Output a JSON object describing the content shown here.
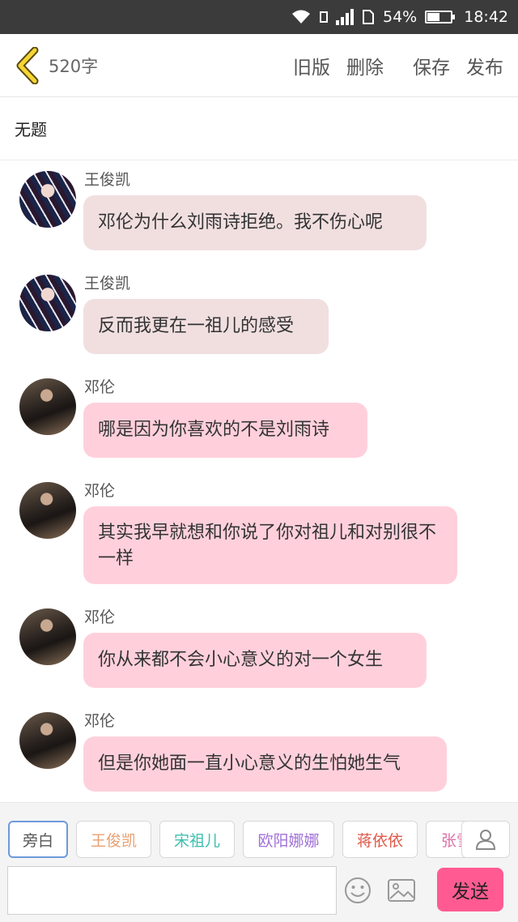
{
  "status": {
    "battery_text": "54%",
    "battery_level": 0.54,
    "time": "18:42"
  },
  "toolbar": {
    "word_count": "520字",
    "old_version": "旧版",
    "delete": "删除",
    "save": "保存",
    "publish": "发布"
  },
  "title": "无题",
  "messages": [
    {
      "sender": "王俊凯",
      "text": "邓伦为什么刘雨诗拒绝。我不伤心呢",
      "avatar": "avatar-wang-junkai"
    },
    {
      "sender": "王俊凯",
      "text": "反而我更在一祖儿的感受",
      "avatar": "avatar-wang-junkai"
    },
    {
      "sender": "邓伦",
      "text": "哪是因为你喜欢的不是刘雨诗",
      "avatar": "avatar-deng-lun"
    },
    {
      "sender": "邓伦",
      "text": "其实我早就想和你说了你对祖儿和对别很不一样",
      "avatar": "avatar-deng-lun"
    },
    {
      "sender": "邓伦",
      "text": "你从来都不会小心意义的对一个女生",
      "avatar": "avatar-deng-lun"
    },
    {
      "sender": "邓伦",
      "text": "但是你她面一直小心意义的生怕她生气",
      "avatar": "avatar-deng-lun"
    }
  ],
  "roles": [
    {
      "label": "旁白",
      "color": "#555555"
    },
    {
      "label": "王俊凯",
      "color": "#e8a070"
    },
    {
      "label": "宋祖儿",
      "color": "#3cbfae"
    },
    {
      "label": "欧阳娜娜",
      "color": "#a070d8"
    },
    {
      "label": "蒋依依",
      "color": "#e05848"
    },
    {
      "label": "张雪",
      "color": "#e070a8"
    }
  ],
  "composer": {
    "placeholder": "",
    "send": "发送"
  },
  "colors": {
    "send_bg": "#ff5b92",
    "bubble_wang": "#f1dfe0",
    "bubble_deng": "#ffd0dc"
  }
}
